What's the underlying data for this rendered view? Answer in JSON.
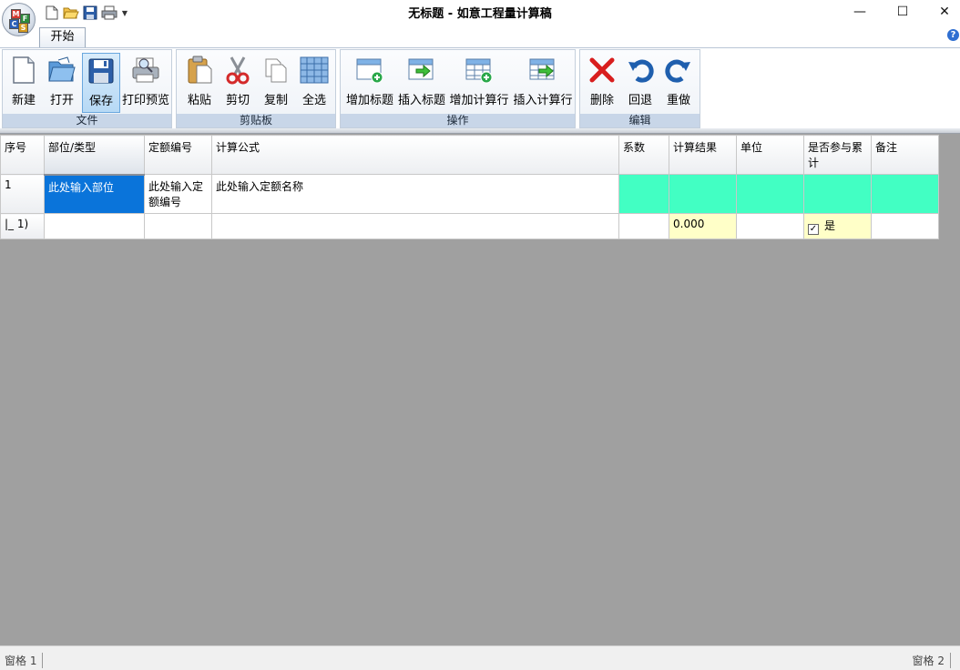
{
  "window": {
    "title": "无标题 - 如意工程量计算稿",
    "minimize_glyph": "—",
    "maximize_glyph": "☐",
    "close_glyph": "✕"
  },
  "app_logo": {
    "letters": [
      "M",
      "F",
      "C",
      "S"
    ]
  },
  "quick_access": [
    {
      "name": "new-file-icon"
    },
    {
      "name": "open-folder-icon"
    },
    {
      "name": "save-disk-icon"
    },
    {
      "name": "printer-icon"
    }
  ],
  "tabs": {
    "start": "开始"
  },
  "help_glyph": "?",
  "ribbon": {
    "file": {
      "label": "文件",
      "new": "新建",
      "open": "打开",
      "save": "保存",
      "print_preview": "打印预览"
    },
    "clipboard": {
      "label": "剪贴板",
      "paste": "粘贴",
      "cut": "剪切",
      "copy": "复制",
      "select_all": "全选"
    },
    "operations": {
      "label": "操作",
      "add_title": "增加标题",
      "insert_title": "插入标题",
      "add_calc_row": "增加计算行",
      "insert_calc_row": "插入计算行"
    },
    "edit": {
      "label": "编辑",
      "delete": "删除",
      "undo": "回退",
      "redo": "重做"
    }
  },
  "grid": {
    "headers": {
      "seq": "序号",
      "part_type": "部位/类型",
      "quota_no": "定额编号",
      "formula": "计算公式",
      "coef": "系数",
      "result": "计算结果",
      "unit": "单位",
      "cumulative": "是否参与累计",
      "remark": "备注"
    },
    "rows": [
      {
        "seq": "1",
        "part_type": "此处输入部位",
        "quota_no": "此处输入定额编号",
        "formula": "此处输入定额名称",
        "coef": "",
        "result": "",
        "unit": "",
        "cumulative": "",
        "remark": ""
      },
      {
        "seq": "|_ 1)",
        "part_type": "",
        "quota_no": "",
        "formula": "",
        "coef": "",
        "result": "0.000",
        "unit": "",
        "cumulative_checked": true,
        "cumulative": "是",
        "remark": ""
      }
    ],
    "colors": {
      "active_cell": "#0a74da",
      "title_row_fill": "#42ffc3",
      "calc_fill": "#ffffc8",
      "workspace": "#a0a0a0"
    }
  },
  "status": {
    "left": "窗格 1",
    "right": "窗格 2"
  }
}
